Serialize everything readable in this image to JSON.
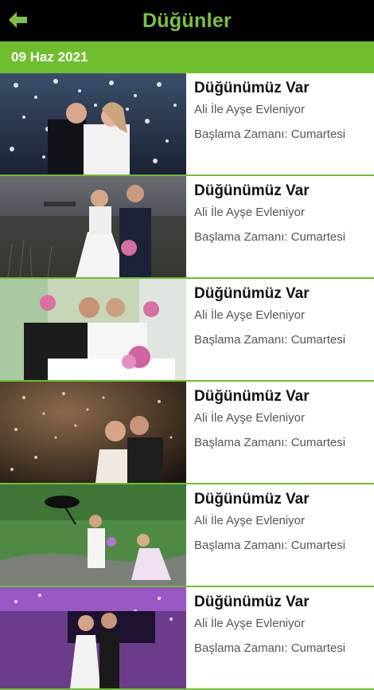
{
  "header": {
    "title": "Düğünler",
    "back_icon": "arrow-left-icon"
  },
  "date_header": "09 Haz 2021",
  "colors": {
    "accent": "#6fbe2e",
    "title": "#7ec241",
    "bar": "#000000"
  },
  "events": [
    {
      "title": "Düğünümüz Var",
      "subtitle": "Ali İle Ayşe Evleniyor",
      "start": "Başlama Zamanı: Cumartesi"
    },
    {
      "title": "Düğünümüz Var",
      "subtitle": "Ali İle Ayşe Evleniyor",
      "start": "Başlama Zamanı: Cumartesi"
    },
    {
      "title": "Düğünümüz Var",
      "subtitle": "Ali İle Ayşe Evleniyor",
      "start": "Başlama Zamanı: Cumartesi"
    },
    {
      "title": "Düğünümüz Var",
      "subtitle": "Ali İle Ayşe Evleniyor",
      "start": "Başlama Zamanı: Cumartesi"
    },
    {
      "title": "Düğünümüz Var",
      "subtitle": "Ali İle Ayşe Evleniyor",
      "start": "Başlama Zamanı: Cumartesi"
    },
    {
      "title": "Düğünümüz Var",
      "subtitle": "Ali İle Ayşe Evleniyor",
      "start": "Başlama Zamanı: Cumartesi"
    }
  ]
}
